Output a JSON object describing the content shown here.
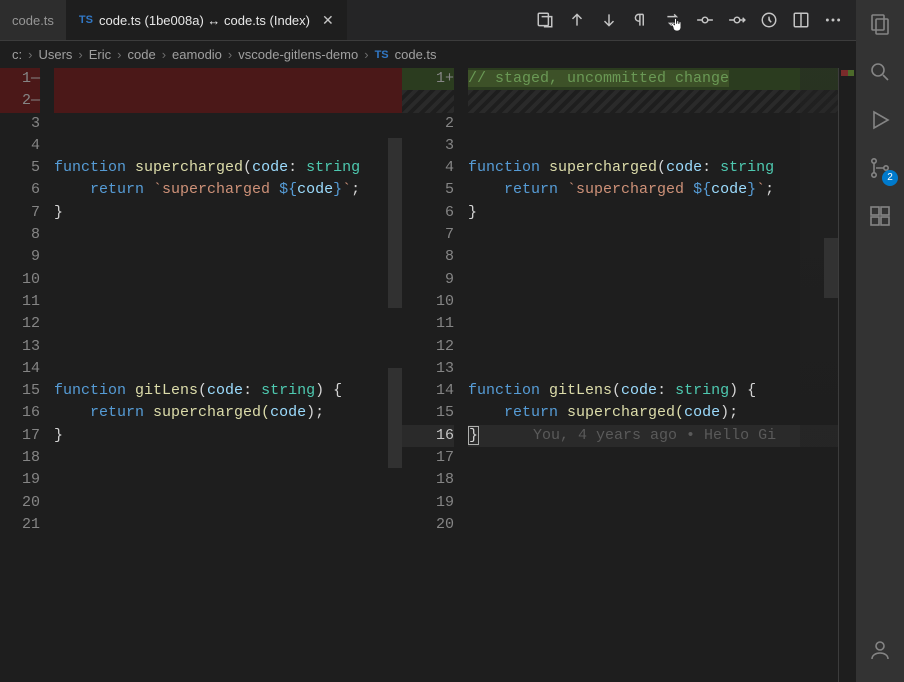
{
  "tabs": {
    "inactive_label": "code.ts",
    "active_label": "code.ts (1be008a) ↔ code.ts (Index)"
  },
  "toolbar_icons": [
    "open-changes-icon",
    "arrow-up-icon",
    "arrow-down-icon",
    "pilcrow-icon",
    "swap-icon",
    "commit-icon",
    "commit-alt-icon",
    "history-icon",
    "split-icon",
    "more-icon"
  ],
  "breadcrumb": {
    "parts": [
      "c:",
      "Users",
      "Eric",
      "code",
      "eamodio",
      "vscode-gitlens-demo"
    ],
    "file": "code.ts"
  },
  "left_pane": {
    "line_numbers": [
      "1",
      "2",
      "3",
      "4",
      "5",
      "6",
      "7",
      "8",
      "9",
      "10",
      "11",
      "12",
      "13",
      "14",
      "15",
      "16",
      "17",
      "18",
      "19",
      "20",
      "21"
    ],
    "deleted_dashes": [
      "—",
      "—"
    ],
    "code": {
      "l4_kw": "function",
      "l4_fn": " supercharged",
      "l4_sig_open": "(",
      "l4_pr": "code",
      "l4_col": ": ",
      "l4_ty": "string",
      "l5_ret": "return",
      "l5_str1": " `supercharged ",
      "l5_tp": "${",
      "l5_var": "code",
      "l5_tp2": "}",
      "l5_str2": "`",
      "l5_end": ";",
      "l6_close": "}",
      "l15_kw": "function",
      "l15_fn": " gitLens",
      "l15_sig_open": "(",
      "l15_pr": "code",
      "l15_col": ": ",
      "l15_ty": "string",
      "l15_sig_close": ") {",
      "l16_ret": "return",
      "l16_call": " supercharged(",
      "l16_arg": "code",
      "l16_call_end": ");",
      "l17_close": "}"
    }
  },
  "right_pane": {
    "line_numbers": [
      "1",
      "2",
      "3",
      "4",
      "5",
      "6",
      "7",
      "8",
      "9",
      "10",
      "11",
      "12",
      "13",
      "14",
      "15",
      "16",
      "17",
      "18",
      "19",
      "20"
    ],
    "added_prefix": "+",
    "added_comment": "// staged, uncommitted change",
    "code": {
      "l4_kw": "function",
      "l4_fn": " supercharged",
      "l4_sig_open": "(",
      "l4_pr": "code",
      "l4_col": ": ",
      "l4_ty": "string",
      "l5_ret": "return",
      "l5_str1": " `supercharged ",
      "l5_tp": "${",
      "l5_var": "code",
      "l5_tp2": "}",
      "l5_str2": "`",
      "l5_end": ";",
      "l6_close": "}",
      "l14_kw": "function",
      "l14_fn": " gitLens",
      "l14_sig_open": "(",
      "l14_pr": "code",
      "l14_col": ": ",
      "l14_ty": "string",
      "l14_sig_close": ") {",
      "l15_ret": "return",
      "l15_call": " supercharged(",
      "l15_arg": "code",
      "l15_call_end": ");",
      "l16_close": "}",
      "blame": "You, 4 years ago • Hello Gi"
    }
  },
  "activity": {
    "scm_badge": "2"
  }
}
